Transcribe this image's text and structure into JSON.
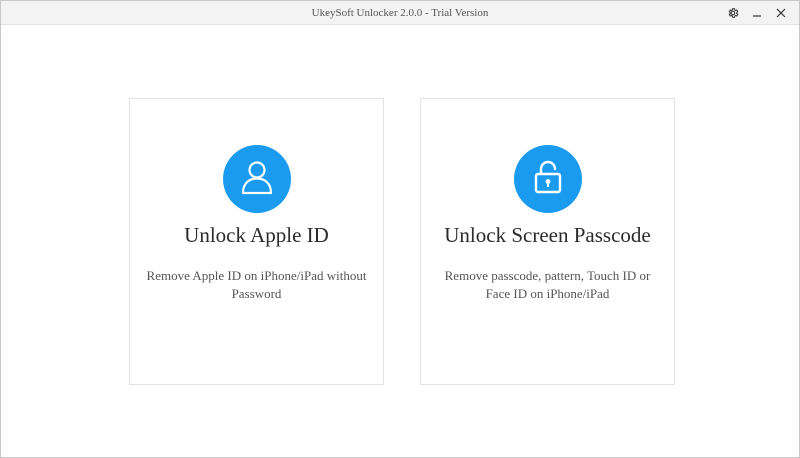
{
  "window": {
    "title": "UkeySoft Unlocker 2.0.0 - Trial Version",
    "controls": {
      "settings_icon": "gear-icon",
      "minimize_icon": "minimize-icon",
      "close_icon": "close-icon"
    }
  },
  "cards": [
    {
      "icon": "user-icon",
      "title": "Unlock Apple ID",
      "description": "Remove Apple ID on iPhone/iPad without Password"
    },
    {
      "icon": "lock-icon",
      "title": "Unlock Screen Passcode",
      "description": "Remove passcode, pattern, Touch ID or Face ID on iPhone/iPad"
    }
  ],
  "colors": {
    "accent": "#1a9bf0",
    "card_border": "#e3e3e3",
    "title_text": "#2b2b2b",
    "desc_text": "#555555"
  }
}
